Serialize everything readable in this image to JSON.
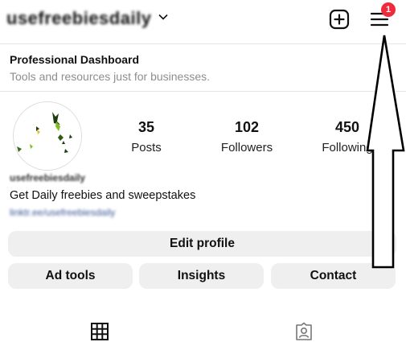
{
  "header": {
    "username": "usefreebiesdaily",
    "notification_count": "1"
  },
  "dashboard": {
    "title": "Professional Dashboard",
    "subtitle": "Tools and resources just for businesses."
  },
  "stats": [
    {
      "value": "35",
      "label": "Posts"
    },
    {
      "value": "102",
      "label": "Followers"
    },
    {
      "value": "450",
      "label": "Following"
    }
  ],
  "bio": {
    "name": "usefreebiesdaily",
    "text": "Get Daily freebies and sweepstakes",
    "link": "linktr.ee/usefreebiesdaily"
  },
  "buttons": {
    "edit_profile": "Edit profile",
    "ad_tools": "Ad tools",
    "insights": "Insights",
    "contact": "Contact"
  },
  "icons": [
    "chevron-down-icon",
    "plus-square-icon",
    "hamburger-menu-icon",
    "grid-icon",
    "tagged-person-icon",
    "arrow-up-annotation"
  ],
  "colors": {
    "badge": "#ef2a3c",
    "button_bg": "#efefef"
  }
}
